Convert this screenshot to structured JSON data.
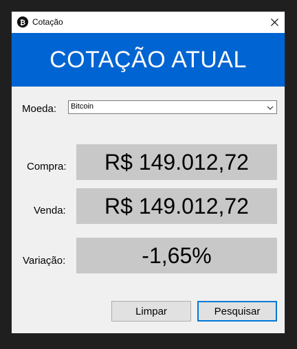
{
  "window": {
    "title": "Cotação",
    "close_icon": "close-icon",
    "app_icon": "bitcoin-app-icon"
  },
  "header": {
    "title": "COTAÇÃO ATUAL",
    "color": "#0064d2"
  },
  "form": {
    "moeda_label": "Moeda:",
    "moeda_selected": "Bitcoin",
    "compra_label": "Compra:",
    "compra_value": "R$ 149.012,72",
    "venda_label": "Venda:",
    "venda_value": "R$ 149.012,72",
    "variacao_label": "Variação:",
    "variacao_value": "-1,65%"
  },
  "buttons": {
    "limpar": "Limpar",
    "pesquisar": "Pesquisar"
  },
  "colors": {
    "accent": "#0078d7",
    "value_box": "#c8c8c8"
  }
}
